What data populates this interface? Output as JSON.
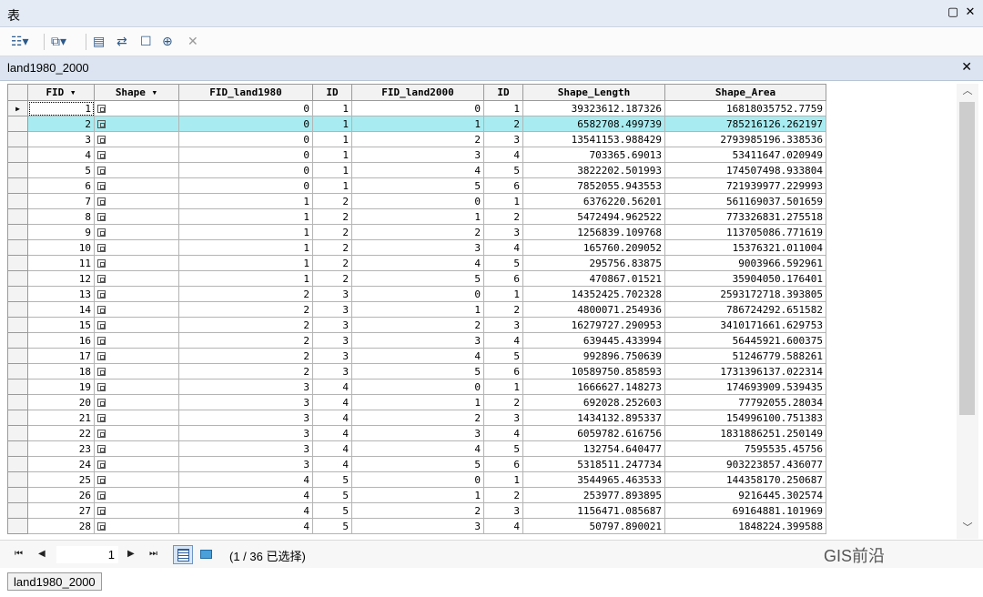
{
  "window": {
    "title": "表"
  },
  "table": {
    "name": "land1980_2000",
    "columns": [
      "FID",
      "Shape",
      "FID_land1980",
      "ID",
      "FID_land2000",
      "ID",
      "Shape_Length",
      "Shape_Area"
    ],
    "highlight_row_index": 1,
    "rows": [
      [
        "1",
        "",
        "0",
        "1",
        "0",
        "1",
        "39323612.187326",
        "16818035752.7759"
      ],
      [
        "2",
        "",
        "0",
        "1",
        "1",
        "2",
        "6582708.499739",
        "785216126.262197"
      ],
      [
        "3",
        "",
        "0",
        "1",
        "2",
        "3",
        "13541153.988429",
        "2793985196.338536"
      ],
      [
        "4",
        "",
        "0",
        "1",
        "3",
        "4",
        "703365.69013",
        "53411647.020949"
      ],
      [
        "5",
        "",
        "0",
        "1",
        "4",
        "5",
        "3822202.501993",
        "174507498.933804"
      ],
      [
        "6",
        "",
        "0",
        "1",
        "5",
        "6",
        "7852055.943553",
        "721939977.229993"
      ],
      [
        "7",
        "",
        "1",
        "2",
        "0",
        "1",
        "6376220.56201",
        "561169037.501659"
      ],
      [
        "8",
        "",
        "1",
        "2",
        "1",
        "2",
        "5472494.962522",
        "773326831.275518"
      ],
      [
        "9",
        "",
        "1",
        "2",
        "2",
        "3",
        "1256839.109768",
        "113705086.771619"
      ],
      [
        "10",
        "",
        "1",
        "2",
        "3",
        "4",
        "165760.209052",
        "15376321.011004"
      ],
      [
        "11",
        "",
        "1",
        "2",
        "4",
        "5",
        "295756.83875",
        "9003966.592961"
      ],
      [
        "12",
        "",
        "1",
        "2",
        "5",
        "6",
        "470867.01521",
        "35904050.176401"
      ],
      [
        "13",
        "",
        "2",
        "3",
        "0",
        "1",
        "14352425.702328",
        "2593172718.393805"
      ],
      [
        "14",
        "",
        "2",
        "3",
        "1",
        "2",
        "4800071.254936",
        "786724292.651582"
      ],
      [
        "15",
        "",
        "2",
        "3",
        "2",
        "3",
        "16279727.290953",
        "3410171661.629753"
      ],
      [
        "16",
        "",
        "2",
        "3",
        "3",
        "4",
        "639445.433994",
        "56445921.600375"
      ],
      [
        "17",
        "",
        "2",
        "3",
        "4",
        "5",
        "992896.750639",
        "51246779.588261"
      ],
      [
        "18",
        "",
        "2",
        "3",
        "5",
        "6",
        "10589750.858593",
        "1731396137.022314"
      ],
      [
        "19",
        "",
        "3",
        "4",
        "0",
        "1",
        "1666627.148273",
        "174693909.539435"
      ],
      [
        "20",
        "",
        "3",
        "4",
        "1",
        "2",
        "692028.252603",
        "77792055.28034"
      ],
      [
        "21",
        "",
        "3",
        "4",
        "2",
        "3",
        "1434132.895337",
        "154996100.751383"
      ],
      [
        "22",
        "",
        "3",
        "4",
        "3",
        "4",
        "6059782.616756",
        "1831886251.250149"
      ],
      [
        "23",
        "",
        "3",
        "4",
        "4",
        "5",
        "132754.640477",
        "7595535.45756"
      ],
      [
        "24",
        "",
        "3",
        "4",
        "5",
        "6",
        "5318511.247734",
        "903223857.436077"
      ],
      [
        "25",
        "",
        "4",
        "5",
        "0",
        "1",
        "3544965.463533",
        "144358170.250687"
      ],
      [
        "26",
        "",
        "4",
        "5",
        "1",
        "2",
        "253977.893895",
        "9216445.302574"
      ],
      [
        "27",
        "",
        "4",
        "5",
        "2",
        "3",
        "1156471.085687",
        "69164881.101969"
      ],
      [
        "28",
        "",
        "4",
        "5",
        "3",
        "4",
        "50797.890021",
        "1848224.399588"
      ]
    ]
  },
  "pager": {
    "current": "1",
    "selection_status": "(1 / 36 已选择)"
  },
  "watermark": "GIS前沿",
  "status_tab": "land1980_2000",
  "colors": {
    "highlight": "#a8ecf1",
    "title_bar": "#e4ebf5",
    "tab_bar": "#dbe4f0"
  },
  "icons": [
    "table-options-icon",
    "related-tables-icon",
    "select-by-attributes-icon",
    "switch-selection-icon",
    "clear-selection-icon",
    "zoom-to-selected-icon",
    "delete-selected-icon"
  ]
}
